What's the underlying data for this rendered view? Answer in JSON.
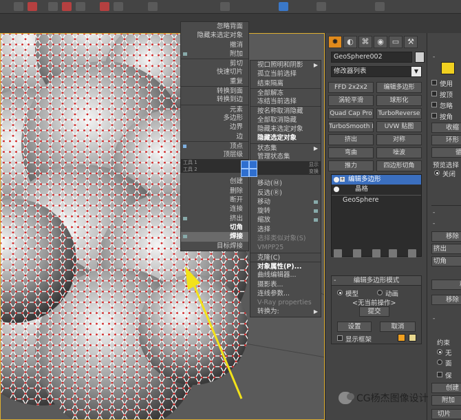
{
  "toolbar": {
    "icons": [
      "tool-icon-1",
      "tool-icon-2",
      "tool-icon-3",
      "tool-icon-4",
      "tool-icon-5",
      "tool-icon-6",
      "tool-icon-7",
      "tool-icon-8",
      "tool-icon-9",
      "tool-icon-10",
      "tool-icon-11",
      "tool-icon-12"
    ]
  },
  "quad_left": {
    "items": [
      {
        "label": "忽略背面",
        "style": "normal"
      },
      {
        "label": "隐藏未选定对象",
        "style": "normal"
      },
      {
        "label": "撤消",
        "style": "normal"
      },
      {
        "label": "附加",
        "style": "normal"
      },
      {
        "label": "剪切",
        "style": "normal"
      },
      {
        "label": "快速切片",
        "style": "normal"
      },
      {
        "label": "重复",
        "style": "normal"
      },
      {
        "label": "转换到面",
        "style": "normal"
      },
      {
        "label": "转换到边",
        "style": "normal"
      },
      {
        "label": "元素",
        "style": "normal"
      },
      {
        "label": "多边形",
        "style": "normal"
      },
      {
        "label": "边界",
        "style": "normal"
      },
      {
        "label": "边",
        "style": "normal"
      },
      {
        "label": "顶点",
        "style": "normal"
      },
      {
        "label": "顶层级",
        "style": "normal"
      }
    ],
    "bar1_left": "工具 1",
    "bar1_right": "显示",
    "bar2_left": "工具 2",
    "bar2_right": "变换",
    "items2": [
      {
        "label": "创建",
        "style": "normal"
      },
      {
        "label": "删除",
        "style": "normal"
      },
      {
        "label": "断开",
        "style": "normal"
      },
      {
        "label": "连接",
        "style": "normal"
      },
      {
        "label": "挤出",
        "style": "normal"
      },
      {
        "label": "切角",
        "style": "bold"
      },
      {
        "label": "焊接",
        "style": "bold"
      },
      {
        "label": "目标焊接",
        "style": "normal"
      }
    ]
  },
  "quad_right": {
    "items": [
      {
        "label": "视口照明和阴影",
        "style": "normal",
        "arrow": "▶"
      },
      {
        "label": "孤立当前选择",
        "style": "normal"
      },
      {
        "label": "结束隔离",
        "style": "normal"
      },
      {
        "label": "全部解冻",
        "style": "normal"
      },
      {
        "label": "冻结当前选择",
        "style": "normal"
      },
      {
        "label": "按名称取消隐藏",
        "style": "normal"
      },
      {
        "label": "全部取消隐藏",
        "style": "normal"
      },
      {
        "label": "隐藏未选定对象",
        "style": "normal"
      },
      {
        "label": "隐藏选定对象",
        "style": "bold"
      },
      {
        "label": "状态集",
        "style": "normal",
        "arrow": "▶"
      },
      {
        "label": "管理状态集",
        "style": "normal"
      }
    ],
    "items2": [
      {
        "label": "移动(Ⓜ)",
        "style": "normal"
      },
      {
        "label": "反选(Ⓡ)",
        "style": "normal"
      },
      {
        "label": "移动",
        "style": "normal"
      },
      {
        "label": "旋转",
        "style": "normal"
      },
      {
        "label": "缩放",
        "style": "normal"
      },
      {
        "label": "选择",
        "style": "normal"
      },
      {
        "label": "选择类似对象(S)",
        "style": "dim"
      },
      {
        "label": "VMPP25",
        "style": "dim"
      },
      {
        "label": "克隆(C)",
        "style": "normal"
      },
      {
        "label": "对象属性(P)...",
        "style": "bold"
      },
      {
        "label": "曲线编辑器...",
        "style": "normal"
      },
      {
        "label": "摄影表...",
        "style": "normal"
      },
      {
        "label": "连线参数...",
        "style": "normal"
      },
      {
        "label": "V-Ray properties",
        "style": "dim"
      },
      {
        "label": "转换为:",
        "style": "normal",
        "arrow": "▶"
      }
    ]
  },
  "command_panel": {
    "tabs": [
      "create-tab",
      "modify-tab",
      "hierarchy-tab",
      "motion-tab",
      "display-tab",
      "utilities-tab"
    ],
    "object_name": "GeoSphere002",
    "modifier_list": "修改器列表",
    "modifier_buttons": [
      "FFD 2x2x2",
      "编辑多边形",
      "涡轮平滑",
      "球形化",
      "Quad Cap Pro",
      "TurboReverse",
      "TurboSmooth Pro",
      "UVW 贴图",
      "挤出",
      "对称",
      "弯曲",
      "噪波",
      "推力",
      "四边形切角"
    ],
    "stack": {
      "items": [
        {
          "label": "编辑多边形",
          "selected": true
        },
        {
          "label": "晶格",
          "selected": false
        },
        {
          "label": "GeoSphere",
          "selected": false
        }
      ]
    },
    "rollout": {
      "title": "编辑多边形模式",
      "mode_model": "模型",
      "mode_anim": "动画",
      "no_op": "<无当前操作>",
      "commit": "提交",
      "settings": "设置",
      "cancel": "取消",
      "show_cage": "显示框架",
      "cage_colors": [
        "#f0a020",
        "#e8d890"
      ]
    }
  },
  "right_panel": {
    "swatch_color": "#f0d020",
    "items": [
      "使用",
      "按顶",
      "忽略",
      "按角",
      "收缩",
      "环形",
      "循",
      "预览选择",
      "关闭",
      "移除",
      "挤出",
      "切角",
      "移",
      "移除",
      "约束",
      "无",
      "面",
      "保",
      "创建",
      "附加",
      "切片"
    ]
  },
  "watermark": {
    "text": "CG杨杰图像设计"
  }
}
